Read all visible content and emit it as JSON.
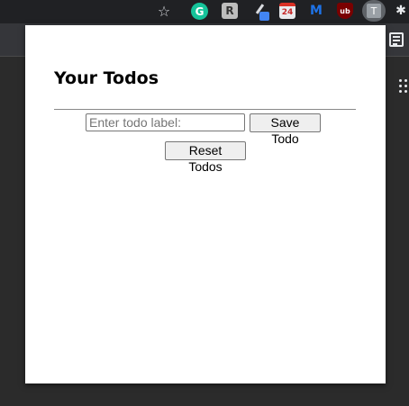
{
  "browser": {
    "toolbar_icons": [
      {
        "name": "bookmark-star-icon",
        "glyph": "☆"
      },
      {
        "name": "grammarly-extension-icon",
        "glyph": "G"
      },
      {
        "name": "extension-r-icon",
        "glyph": "R"
      },
      {
        "name": "extension-pen-icon",
        "glyph": ""
      },
      {
        "name": "extension-calendar-icon",
        "glyph": "24"
      },
      {
        "name": "malwarebytes-extension-icon",
        "glyph": "M"
      },
      {
        "name": "ublock-extension-icon",
        "glyph": "ub"
      },
      {
        "name": "todo-extension-icon",
        "glyph": "T"
      },
      {
        "name": "extensions-puzzle-icon",
        "glyph": "✱"
      }
    ]
  },
  "popup": {
    "title": "Your Todos",
    "input": {
      "placeholder": "Enter todo label:",
      "value": ""
    },
    "save_label": "Save Todo",
    "reset_label": "Reset Todos"
  },
  "colors": {
    "toolbar": "#202124",
    "background": "#2b2b2b",
    "popup": "#ffffff",
    "grammarly": "#15c39a",
    "button_bg": "#efefef"
  }
}
